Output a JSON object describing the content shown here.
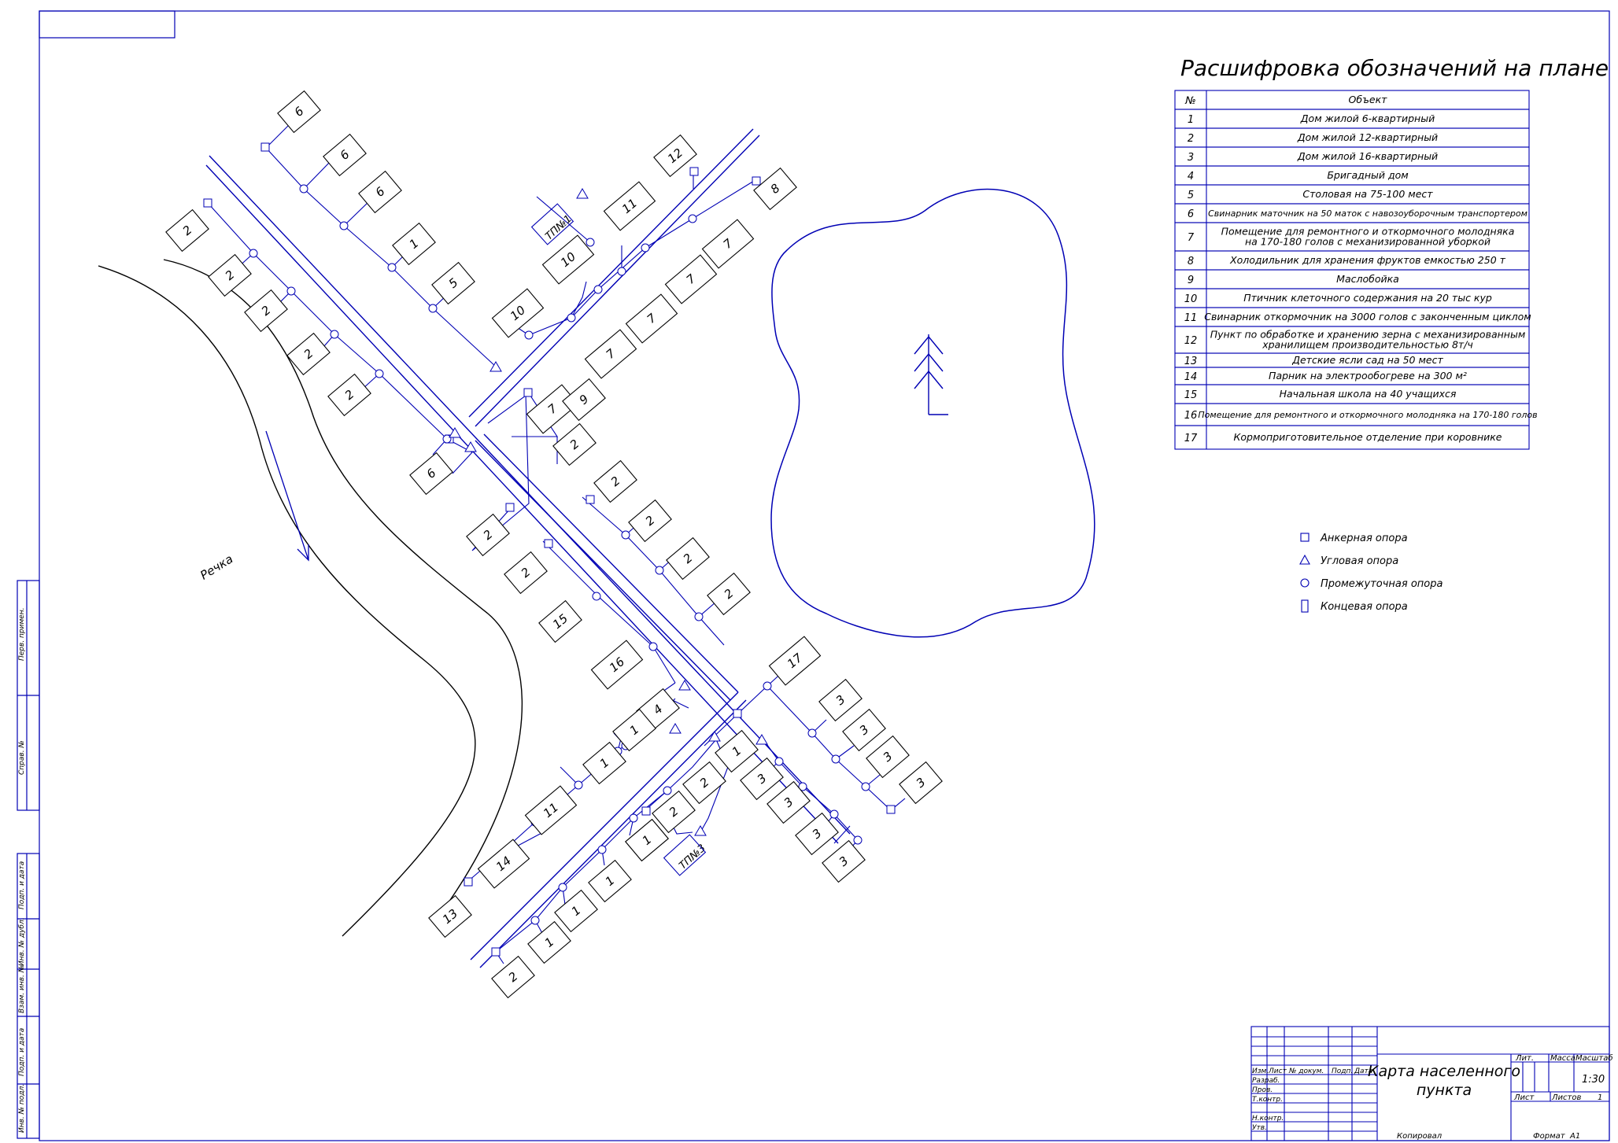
{
  "legend_title": "Расшифровка обозначений на плане",
  "legend_header": {
    "num": "№",
    "object": "Объект"
  },
  "legend_rows": [
    {
      "num": "1",
      "lines": [
        "Дом жилой 6-квартирный"
      ]
    },
    {
      "num": "2",
      "lines": [
        "Дом жилой 12-квартирный"
      ]
    },
    {
      "num": "3",
      "lines": [
        "Дом жилой 16-квартирный"
      ]
    },
    {
      "num": "4",
      "lines": [
        "Бригадный дом"
      ]
    },
    {
      "num": "5",
      "lines": [
        "Столовая на 75-100 мест"
      ]
    },
    {
      "num": "6",
      "lines": [
        "Свинарник маточник на 50 маток с  навозоуборочным транспортером"
      ]
    },
    {
      "num": "7",
      "lines": [
        "Помещение для ремонтного и откормочного молодняка",
        "на 170-180 голов с механизированной уборкой"
      ]
    },
    {
      "num": "8",
      "lines": [
        "Холодильник для хранения фруктов емкостью 250 т"
      ]
    },
    {
      "num": "9",
      "lines": [
        "Маслобойка"
      ]
    },
    {
      "num": "10",
      "lines": [
        "Птичник  клеточного содержания на 20 тыс кур"
      ]
    },
    {
      "num": "11",
      "lines": [
        "Свинарник откормочник на 3000 голов с законченным циклом"
      ]
    },
    {
      "num": "12",
      "lines": [
        "Пункт по обработке и хранению зерна с механизированным",
        "хранилищем производительностью 8т/ч"
      ]
    },
    {
      "num": "13",
      "lines": [
        "Детские ясли сад на 50 мест"
      ]
    },
    {
      "num": "14",
      "lines": [
        "Парник на электрообогреве на 300 м²"
      ]
    },
    {
      "num": "15",
      "lines": [
        "Начальная школа на 40 учащихся"
      ]
    },
    {
      "num": "16",
      "lines": [
        "Помещение для ремонтного и откормочного молодняка на 170-180 голов"
      ]
    },
    {
      "num": "17",
      "lines": [
        "Кормоприготовительное отделение при коровнике"
      ]
    }
  ],
  "support_legend": [
    {
      "symbol": "square",
      "label": "Анкерная опора"
    },
    {
      "symbol": "triangle",
      "label": "Угловая опора"
    },
    {
      "symbol": "circle",
      "label": "Промежуточная опора"
    },
    {
      "symbol": "rect",
      "label": "Концевая опора"
    }
  ],
  "map_labels": {
    "river": "Речка",
    "tp1": "ТП№1",
    "tp3": "ТП№3"
  },
  "buildings": [
    "6",
    "6",
    "6",
    "1",
    "5",
    "10",
    "10",
    "11",
    "12",
    "8",
    "7",
    "7",
    "7",
    "7",
    "7",
    "9",
    "2",
    "2",
    "2",
    "2",
    "2",
    "6",
    "2",
    "2",
    "2",
    "2",
    "2",
    "2",
    "2",
    "15",
    "16",
    "17",
    "3",
    "3",
    "3",
    "3",
    "3",
    "3",
    "3",
    "3",
    "4",
    "1",
    "1",
    "11",
    "14",
    "13",
    "1",
    "1",
    "1",
    "1",
    "2",
    "2",
    "2",
    "1",
    "1"
  ],
  "side_stamp": [
    "Перв. примен.",
    "Справ. №",
    "Подп. и дата",
    "Инв. № дубл.",
    "Взам. инв. №",
    "Подп. и дата",
    "Инв. № подл."
  ],
  "title_block": {
    "title": [
      "Карта населенного",
      "пункта"
    ],
    "headers": [
      "Изм.",
      "Лист",
      "№ докум.",
      "Подп.",
      "Дата"
    ],
    "roles": [
      "Разраб.",
      "Пров.",
      "Т.контр.",
      "",
      "Н.контр.",
      "Утв."
    ],
    "lit": "Лит.",
    "mass": "Масса",
    "scale_label": "Масштаб",
    "scale": "1:30",
    "sheet": "Лист",
    "sheets": "Листов",
    "sheets_value": "1"
  },
  "footer": {
    "copied": "Копировал",
    "format": "Формат",
    "format_value": "А1"
  },
  "colors": {
    "line": "#0000b4",
    "paper": "#ffffff",
    "text": "#000000",
    "river": "#000000"
  }
}
